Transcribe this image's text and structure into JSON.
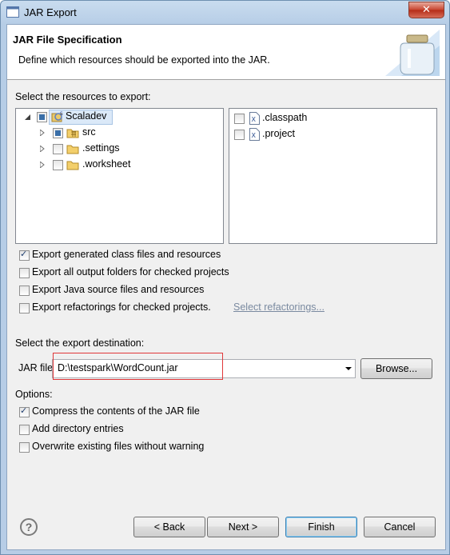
{
  "window": {
    "title": "JAR Export",
    "close_symbol": "✕"
  },
  "header": {
    "title": "JAR File Specification",
    "description": "Define which resources should be exported into the JAR."
  },
  "resources": {
    "label": "Select the resources to export:",
    "tree": [
      {
        "label": "Scaladev",
        "state": "partial",
        "expanded": true,
        "icon": "project-icon"
      },
      {
        "label": "src",
        "state": "partial",
        "expanded": false,
        "icon": "package-folder-icon"
      },
      {
        "label": ".settings",
        "state": "unchecked",
        "expanded": false,
        "icon": "folder-icon"
      },
      {
        "label": ".worksheet",
        "state": "unchecked",
        "expanded": false,
        "icon": "folder-icon"
      }
    ],
    "files": [
      {
        "label": ".classpath",
        "state": "unchecked",
        "icon": "xml-file-icon"
      },
      {
        "label": ".project",
        "state": "unchecked",
        "icon": "xml-file-icon"
      }
    ]
  },
  "export_options": [
    {
      "label": "Export generated class files and resources",
      "checked": true
    },
    {
      "label": "Export all output folders for checked projects",
      "checked": false
    },
    {
      "label": "Export Java source files and resources",
      "checked": false
    },
    {
      "label": "Export refactorings for checked projects.",
      "checked": false,
      "link": "Select refactorings..."
    }
  ],
  "destination": {
    "label": "Select the export destination:",
    "jar_file_label": "JAR file:",
    "jar_file_value": "D:\\testspark\\WordCount.jar",
    "browse_label": "Browse..."
  },
  "options": {
    "label": "Options:",
    "items": [
      {
        "label": "Compress the contents of the JAR file",
        "checked": true
      },
      {
        "label": "Add directory entries",
        "checked": false
      },
      {
        "label": "Overwrite existing files without warning",
        "checked": false
      }
    ]
  },
  "footer": {
    "help_symbol": "?",
    "back_label": "< Back",
    "next_label": "Next >",
    "finish_label": "Finish",
    "cancel_label": "Cancel"
  },
  "colors": {
    "highlight_box": "#e0383a",
    "link": "#7a8aa0",
    "default_button_border": "#3c7fb1"
  }
}
